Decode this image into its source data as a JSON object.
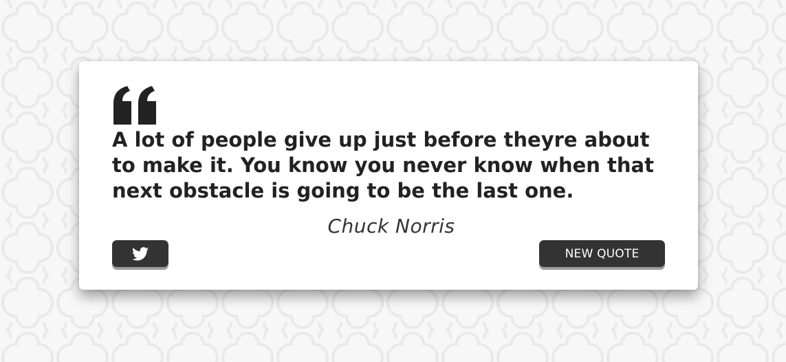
{
  "quote": {
    "text": "A lot of people give up just before theyre about to make it. You know you never know when that next obstacle is going to be the last one.",
    "author": "Chuck Norris"
  },
  "buttons": {
    "tweet_icon": "twitter-icon",
    "new_quote_label": "NEW QUOTE"
  },
  "colors": {
    "background": "#f7f7f7",
    "pattern": "#ebebeb",
    "card": "#ffffff",
    "text": "#222222",
    "button": "#333333",
    "button_shadow": "#9a9a9a"
  },
  "icons": {
    "quote_mark": "quote-open-icon"
  }
}
